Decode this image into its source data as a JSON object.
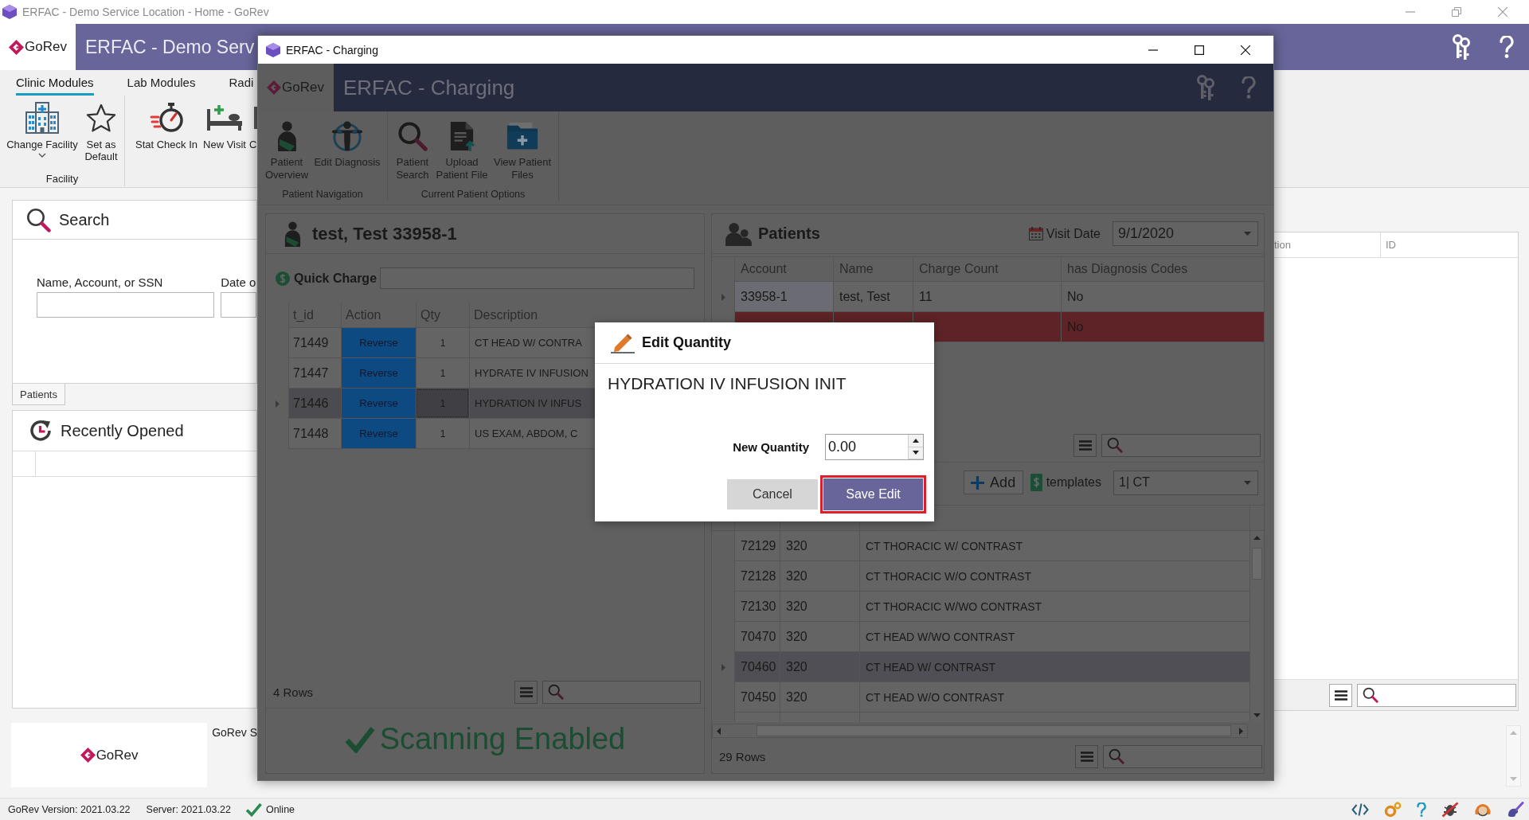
{
  "main_window": {
    "title": "ERFAC - Demo Service Location - Home - GoRev",
    "header": {
      "logo": "GoRev",
      "title": "ERFAC - Demo Serv"
    },
    "tabs": [
      {
        "label": "Clinic Modules",
        "selected": true
      },
      {
        "label": "Lab Modules",
        "selected": false
      },
      {
        "label": "Radi",
        "selected": false
      }
    ],
    "ribbon": [
      {
        "group": "Facility",
        "buttons": [
          {
            "label": "Change Facility",
            "dropdown": true
          },
          {
            "label": "Set as Default",
            "dropdown": false
          }
        ]
      },
      {
        "buttons": [
          {
            "label": "Stat Check In",
            "dropdown": false
          },
          {
            "label": "New Visit",
            "dropdown": false
          },
          {
            "label": "C",
            "dropdown": false
          }
        ]
      }
    ],
    "search_panel": {
      "title": "Search",
      "fields": [
        {
          "label": "Name, Account, or SSN"
        },
        {
          "label": "Date o"
        }
      ],
      "tabs": [
        {
          "label": "Patients",
          "selected": true
        }
      ]
    },
    "recent_panel": {
      "title": "Recently Opened"
    },
    "footer": {
      "logo": "GoRev",
      "text": "GoRev S"
    },
    "side_table": {
      "columns": [
        "tion",
        "ID"
      ]
    },
    "status_bar": {
      "version": "GoRev Version: 2021.03.22",
      "server": "Server: 2021.03.22",
      "connection": "Online"
    }
  },
  "charging_window": {
    "title": "ERFAC - Charging",
    "header": {
      "logo": "GoRev",
      "title": "ERFAC - Charging"
    },
    "ribbon": [
      {
        "group": "Patient Navigation",
        "buttons": [
          "Patient Overview",
          "Edit Diagnosis"
        ]
      },
      {
        "group": "Current Patient Options",
        "buttons": [
          "Patient Search",
          "Upload Patient File",
          "View Patient Files"
        ]
      }
    ],
    "patient_panel": {
      "title": "test, Test 33958-1",
      "quick_charge": "Quick Charge",
      "table": {
        "columns": [
          "t_id",
          "Action",
          "Qty",
          "Description"
        ],
        "rows": [
          {
            "t_id": "71449",
            "action": "Reverse",
            "qty": "1",
            "description": "CT HEAD W/ CONTRA",
            "selected": false
          },
          {
            "t_id": "71447",
            "action": "Reverse",
            "qty": "1",
            "description": "HYDRATE IV INFUSION",
            "selected": false
          },
          {
            "t_id": "71446",
            "action": "Reverse",
            "qty": "1",
            "description": "HYDRATION IV INFUS",
            "selected": true
          },
          {
            "t_id": "71448",
            "action": "Reverse",
            "qty": "1",
            "description": "US EXAM, ABDOM, C",
            "selected": false
          }
        ]
      },
      "row_count": "4 Rows",
      "scanner": "Scanning Enabled"
    },
    "patients_panel": {
      "title": "Patients",
      "visit_date": {
        "label": "Visit Date",
        "value": "9/1/2020"
      },
      "table": {
        "columns": [
          "Account",
          "Name",
          "Charge Count",
          "has Diagnosis Codes"
        ],
        "rows": [
          {
            "account": "33958-1",
            "name": "test, Test",
            "charge_count": "11",
            "diagnosis": "No",
            "selected": true,
            "flagged": false
          },
          {
            "diagnosis": "No",
            "selected": false,
            "flagged": true
          }
        ]
      },
      "add": "Add",
      "templates": {
        "label": "templates",
        "value": "1| CT"
      },
      "charges": {
        "rows": [
          {
            "cpt": "72129",
            "rev_code": "320",
            "description": "CT THORACIC W/ CONTRAST",
            "selected": false
          },
          {
            "cpt": "72128",
            "rev_code": "320",
            "description": "CT THORACIC W/O CONTRAST",
            "selected": false
          },
          {
            "cpt": "72130",
            "rev_code": "320",
            "description": "CT THORACIC W/WO CONTRAST",
            "selected": false
          },
          {
            "cpt": "70470",
            "rev_code": "320",
            "description": "CT HEAD W/WO CONTRAST",
            "selected": false
          },
          {
            "cpt": "70460",
            "rev_code": "320",
            "description": "CT HEAD W/ CONTRAST",
            "selected": true
          },
          {
            "cpt": "70450",
            "rev_code": "320",
            "description": "CT HEAD W/O CONTRAST",
            "selected": false
          }
        ]
      },
      "row_count": "29 Rows"
    }
  },
  "dialog": {
    "title": "Edit Quantity",
    "item": "HYDRATION IV INFUSION INIT",
    "quantity": {
      "label": "New Quantity",
      "value": "0.00"
    },
    "buttons": [
      {
        "label": "Cancel",
        "kind": "secondary",
        "highlighted": false
      },
      {
        "label": "Save Edit",
        "kind": "primary",
        "highlighted": true
      }
    ]
  }
}
